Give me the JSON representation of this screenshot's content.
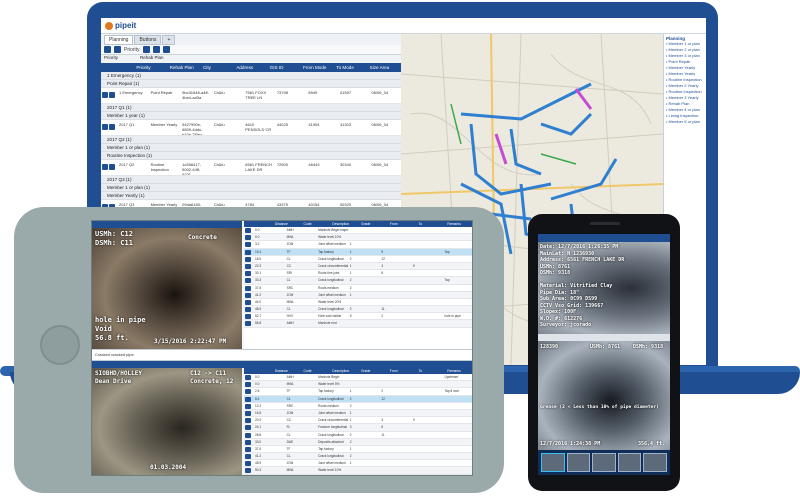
{
  "laptop": {
    "brand": "pipeit",
    "tabs": [
      "Planning",
      "Buttons",
      "+"
    ],
    "toolbar": {
      "dropdown": "Priority"
    },
    "grid_tabs": [
      "Priority",
      "Rehab Plan"
    ],
    "columns": [
      "Priority",
      "Rehab Plan",
      "City",
      "Address",
      "GIS ID",
      "From Mode",
      "To Mode",
      "Size Area"
    ],
    "groups": [
      {
        "label": "1 Emergency (1)",
        "rows": []
      },
      {
        "label": "Point Repair (1)",
        "rows": [
          {
            "cells": [
              "1 Emergency",
              "Point Repair",
              "9bc31648-a4ff-4be4-ad3a",
              "Ch&lu",
              "7561 FOXX TREE LN",
              "73798",
              "8949",
              "01597",
              "06/06_04"
            ]
          }
        ]
      },
      {
        "label": "2017 Q1 (1)",
        "rows": []
      },
      {
        "label": "Member 1 year (1)",
        "rows": [
          {
            "cells": [
              "2017 Q1",
              "Member Yearly",
              "5427990e-6809-4ddu-b10e-2f3ec-e76e05",
              "Ch&lu",
              "4610 PENSOLD CR",
              "44025",
              "41904",
              "41303",
              "06/06_04"
            ]
          }
        ]
      },
      {
        "label": "2017 Q2 (1)",
        "rows": []
      },
      {
        "label": "Member 1 or plan (1)",
        "rows": []
      },
      {
        "label": "Routine Inspection (1)",
        "rows": [
          {
            "cells": [
              "2017 Q2",
              "Routine Inspection",
              "1c558417-5002-44ff-9231-6bb5d78c94d",
              "Ch&lu",
              "6561 FRENCH LAKE DR",
              "72500",
              "46443",
              "30340",
              "06/06_04"
            ]
          }
        ]
      },
      {
        "label": "2017 Q3 (1)",
        "rows": []
      },
      {
        "label": "Member 1 or plan (1)",
        "rows": []
      },
      {
        "label": "Member Yearly (1)",
        "rows": [
          {
            "cells": [
              "2017 Q3",
              "Member Yearly",
              "09da6180-b47f-46b0-8f11-d3bd3d4e",
              "Ch&lu",
              "4784 PENSOLD CR",
              "43379",
              "40154",
              "00320",
              "06/06_04"
            ]
          }
        ]
      }
    ],
    "legend": {
      "title": "Planning",
      "items": [
        "Member 1 or plan",
        "Member 2 or plan",
        "Member 3 or plan",
        "Point Repair",
        "Member Yearly",
        "Member Yearly",
        "Routine Inspection",
        "Member 2 Yearly",
        "Routine Inspection",
        "Member 3 Yearly",
        "Rehab Plan",
        "Member 4 or plan",
        "Lining Inspection",
        "Member 5 or plan"
      ]
    }
  },
  "tablet": {
    "top_video": {
      "line1": "USMh: C12",
      "line2": "DSMh: C11",
      "tag": "Concrete",
      "bl1": "hole in pipe",
      "bl2": "Void",
      "bl3": "56.8 ft.",
      "date": "3/15/2016 2:22:47 PM"
    },
    "bottom_video": {
      "line1": "SIOBHD/HOLLEY",
      "line2": "Dean Drive",
      "tr1": "C12 -> C11",
      "tr2": "Concrete, 12",
      "date": "01.03.2004"
    },
    "divider_label": "Cracked cracked pipe",
    "table_columns": [
      "Distance",
      "Code",
      "Description",
      "Grade",
      "From",
      "To",
      "Remarks"
    ],
    "top_rows": [
      [
        "0.0",
        "AMH",
        "Manhole Begin Inspection",
        "",
        "",
        "",
        ""
      ],
      [
        "0.0",
        "MWL",
        "Water level 10%",
        "",
        "",
        "",
        ""
      ],
      [
        "3.2",
        "JOM",
        "Joint offset medium",
        "1",
        "",
        "",
        ""
      ],
      [
        "15.4",
        "TF",
        "Tap factory",
        "1",
        "9",
        "",
        "Tap"
      ],
      [
        "18.5",
        "CL",
        "Crack longitudinal",
        "2",
        "12",
        "",
        ""
      ],
      [
        "22.3",
        "CC",
        "Crack circumferential",
        "1",
        "3",
        "9",
        ""
      ],
      [
        "30.1",
        "SRI",
        "Roots fine joint",
        "1",
        "6",
        "",
        ""
      ],
      [
        "33.3",
        "CL",
        "Crack longitudinal",
        "2",
        "",
        "",
        "Tap"
      ],
      [
        "37.5",
        "SRC",
        "Roots medium",
        "2",
        "",
        "",
        ""
      ],
      [
        "41.2",
        "JOM",
        "Joint offset medium",
        "1",
        "",
        "",
        ""
      ],
      [
        "44.0",
        "MWL",
        "Water level 20%",
        "",
        "",
        "",
        ""
      ],
      [
        "48.9",
        "CL",
        "Crack longitudinal",
        "2",
        "11",
        "",
        ""
      ],
      [
        "52.7",
        "HVV",
        "Hole void visible",
        "5",
        "2",
        "",
        "hole in pipe"
      ],
      [
        "56.8",
        "AMH",
        "Manhole end",
        "",
        "",
        "",
        ""
      ]
    ],
    "bottom_rows": [
      [
        "0.0",
        "AMH",
        "Manhole Begin",
        "",
        "",
        "",
        "Upstream"
      ],
      [
        "0.0",
        "MWL",
        "Water level 5%",
        "",
        "",
        "",
        ""
      ],
      [
        "2.6",
        "TF",
        "Tap factory",
        "1",
        "2",
        "",
        "Tap 8 inch"
      ],
      [
        "8.4",
        "CL",
        "Crack longitudinal",
        "2",
        "12",
        "",
        ""
      ],
      [
        "12.3",
        "SRC",
        "Roots medium",
        "2",
        "",
        "",
        ""
      ],
      [
        "16.5",
        "JOM",
        "Joint offset medium",
        "1",
        "",
        "",
        ""
      ],
      [
        "20.2",
        "CC",
        "Crack circumferential",
        "1",
        "3",
        "9",
        ""
      ],
      [
        "24.1",
        "FL",
        "Fracture longitudinal",
        "3",
        "6",
        "",
        ""
      ],
      [
        "28.8",
        "CL",
        "Crack longitudinal",
        "2",
        "11",
        "",
        ""
      ],
      [
        "33.0",
        "DAE",
        "Deposits attached",
        "2",
        "",
        "",
        ""
      ],
      [
        "37.6",
        "TF",
        "Tap factory",
        "1",
        "",
        "",
        ""
      ],
      [
        "41.2",
        "CL",
        "Crack longitudinal",
        "2",
        "",
        "",
        ""
      ],
      [
        "45.9",
        "JOM",
        "Joint offset medium",
        "1",
        "",
        "",
        ""
      ],
      [
        "50.3",
        "MWL",
        "Water level 10%",
        "",
        "",
        "",
        ""
      ],
      [
        "54.7",
        "CC",
        "Crack circumferential",
        "1",
        "",
        "",
        ""
      ],
      [
        "58.1",
        "SRI",
        "Roots fine",
        "1",
        "",
        "",
        ""
      ],
      [
        "62.0",
        "AMH",
        "Manhole end",
        "",
        "",
        "",
        ""
      ]
    ]
  },
  "phone": {
    "lines": [
      "Date: 12/7/2016 1:26:35 PM",
      "MainLat: N 1236930",
      "Address: 6561 FRENCH LAKE DR",
      "USMh: 8761",
      "DSMh: 9318",
      "",
      "Material: Vitrified Clay",
      "Pipe Dia: 18\"",
      "Sub Area: 0C99 DS99",
      "CCTV Vso Grid: 139667",
      "Slopex: 100F",
      "W.O. #: 612276",
      "Surveyor: jcorado"
    ],
    "mid": {
      "left": "128390",
      "center": "USMh: 8761",
      "right": "DSMh: 9318"
    },
    "caption": "Grease (2 < Less than 10% of pipe diameter)",
    "date": "12/7/2016 1:24:38 PM",
    "distance": "356.4 ft."
  },
  "colors": {
    "brand": "#1f4e93",
    "accent": "#e07a1f",
    "map_road": "#2f7fd0",
    "map_highlight": "#c64bd4"
  }
}
